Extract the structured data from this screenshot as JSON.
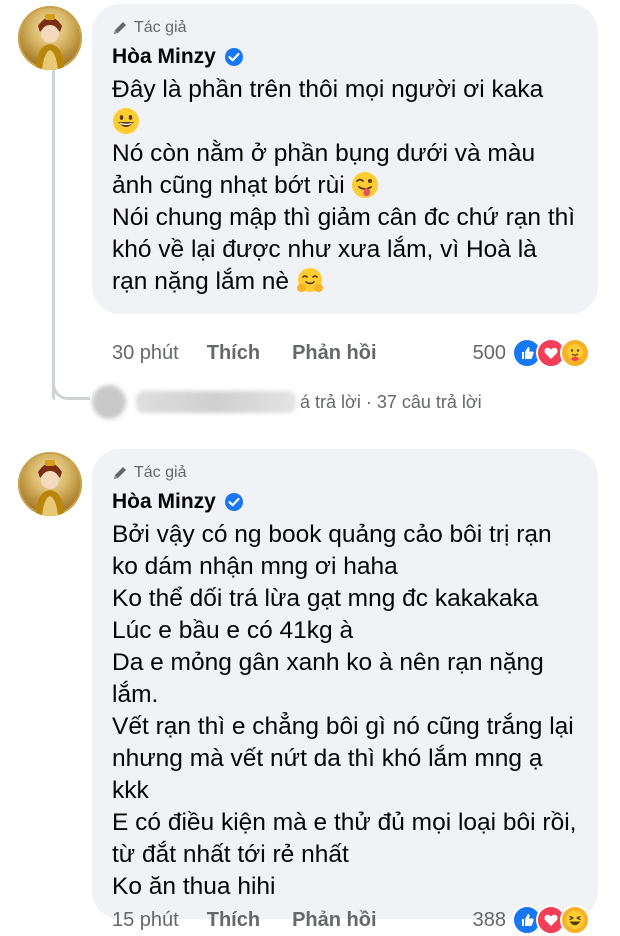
{
  "comments": [
    {
      "author_badge": "Tác giả",
      "author_name": "Hòa Minzy",
      "lines": [
        "Đây là phần trên thôi mọi người ơi kaka",
        "Nó còn nằm ở phần bụng dưới và màu ảnh cũng nhạt bớt rùi",
        "Nói chung mập thì giảm cân đc chứ rạn thì khó về lại được như xưa lắm, vì Hoà là rạn nặng lắm nè"
      ],
      "emojis": [
        "grinning-face-emoji",
        "tongue-out-emoji",
        "hugging-face-emoji"
      ],
      "time": "30 phút",
      "like_label": "Thích",
      "reply_label": "Phản hồi",
      "reaction_count": "500",
      "reaction_icons": [
        "like-reaction",
        "love-reaction",
        "care-reaction"
      ]
    },
    {
      "author_badge": "Tác giả",
      "author_name": "Hòa Minzy",
      "lines": [
        "Bởi vậy có ng book quảng cảo bôi trị rạn ko dám nhận mng ơi haha",
        "Ko thể dối trá lừa gạt mng đc kakakaka",
        "Lúc e bầu e có 41kg à",
        "Da e mỏng gân xanh ko à nên rạn nặng lắm.",
        "Vết rạn thì e chẳng bôi gì nó cũng trắng lại nhưng mà vết nứt da thì khó lắm mng ạ kkk",
        "E có điều kiện mà e thử đủ mọi loại bôi rồi, từ đắt nhất tới rẻ nhất",
        "Ko ăn thua hihi"
      ],
      "time": "15 phút",
      "like_label": "Thích",
      "reply_label": "Phản hồi",
      "reaction_count": "388",
      "reaction_icons": [
        "like-reaction",
        "love-reaction",
        "haha-reaction"
      ]
    }
  ],
  "replies_row": {
    "partial_text": "á trả lời",
    "separator": "·",
    "reply_count_text": "37 câu trả lời"
  },
  "colors": {
    "bubble": "#f0f2f5",
    "secondary_text": "#65676b",
    "like_blue": "#1877f2",
    "love_red": "#f33e58",
    "haha_yellow": "#f7b125"
  }
}
